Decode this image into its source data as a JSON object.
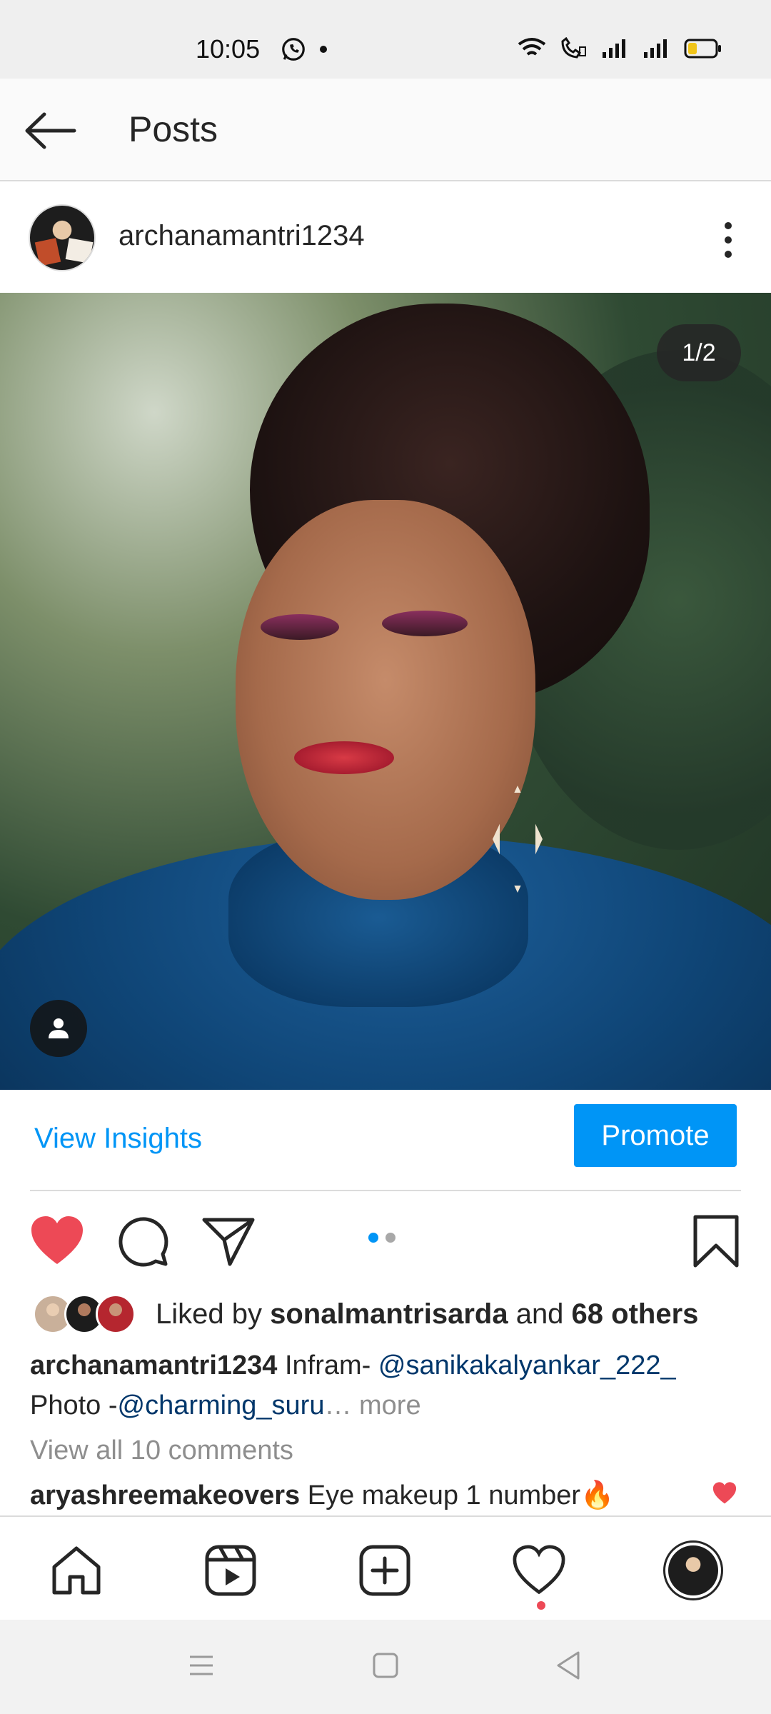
{
  "status_bar": {
    "time": "10:05"
  },
  "header": {
    "title": "Posts"
  },
  "post": {
    "username": "archanamantri1234",
    "image_counter": "1/2",
    "insights_label": "View Insights",
    "promote_label": "Promote",
    "liked": {
      "prefix": "Liked by ",
      "user": "sonalmantrisarda",
      "and": " and ",
      "others": "68 others"
    },
    "caption": {
      "user": "archanamantri1234",
      "text1": " Infram- ",
      "mention1": "@sanikakalyankar_222_",
      "text2": "Photo -",
      "mention2": "@charming_suru",
      "ellipsis": "… ",
      "more": "more"
    },
    "view_all_comments": "View all 10 comments",
    "top_comment": {
      "user": "aryashreemakeovers",
      "text": " Eye makeup 1 number🔥"
    }
  },
  "colors": {
    "accent": "#0095f6",
    "like": "#ed4956",
    "text": "#262626",
    "muted": "#8e8e8e"
  },
  "icons": [
    "back-arrow-icon",
    "more-options-icon",
    "tag-people-icon",
    "heart-filled-icon",
    "comment-icon",
    "share-icon",
    "bookmark-icon",
    "home-icon",
    "reels-icon",
    "create-icon",
    "activity-icon",
    "profile-icon"
  ]
}
